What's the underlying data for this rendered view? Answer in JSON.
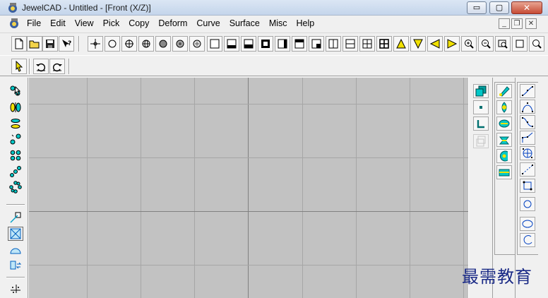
{
  "window": {
    "title": "JewelCAD - Untitled - [Front (X/Z)]",
    "min_glyph": "▭",
    "max_glyph": "▢",
    "close_glyph": "✕"
  },
  "menu": {
    "items": [
      "File",
      "Edit",
      "View",
      "Pick",
      "Copy",
      "Deform",
      "Curve",
      "Surface",
      "Misc",
      "Help"
    ],
    "mdi_min": "_",
    "mdi_restore": "❐",
    "mdi_close": "✕"
  },
  "icons": {
    "app": "jewelcad-app-icon",
    "document": "document-app-icon"
  },
  "colors": {
    "canvas_bg": "#c2c2c2",
    "grid_line": "#a6a6a6",
    "axis_line": "#808080",
    "accent_cyan": "#00c8c8",
    "accent_yellow": "#f0e000",
    "watermark": "#1a2a86"
  },
  "watermark": "最需教育"
}
